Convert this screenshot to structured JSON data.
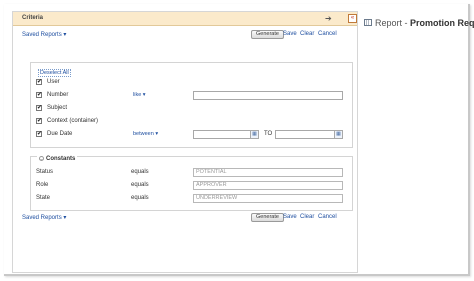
{
  "panel": {
    "title": "Criteria",
    "arrow_glyph": "➔",
    "collapse_glyph": "«"
  },
  "toolbar_top": {
    "saved_reports": "Saved Reports ▾",
    "generate": "Generate",
    "save": "Save",
    "clear": "Clear",
    "cancel": "Cancel"
  },
  "toolbar_bottom": {
    "saved_reports": "Saved Reports ▾",
    "generate": "Generate",
    "save": "Save",
    "clear": "Clear",
    "cancel": "Cancel"
  },
  "criteria": {
    "deselect_all": "Deselect All",
    "check_glyph": "✔",
    "rows": [
      {
        "label": "User",
        "checked": true,
        "operator": "",
        "value": ""
      },
      {
        "label": "Number",
        "checked": true,
        "operator": "like ▾",
        "value": ""
      },
      {
        "label": "Subject",
        "checked": true,
        "operator": "",
        "value": ""
      },
      {
        "label": "Context (container)",
        "checked": true,
        "operator": "",
        "value": ""
      },
      {
        "label": "Due Date",
        "checked": true,
        "operator": "between ▾",
        "value": "",
        "to_label": "TO",
        "to_value": ""
      }
    ]
  },
  "constants": {
    "title": "Constants",
    "rows": [
      {
        "label": "Status",
        "operator": "equals",
        "value": "POTENTIAL"
      },
      {
        "label": "Role",
        "operator": "equals",
        "value": "APPROVER"
      },
      {
        "label": "State",
        "operator": "equals",
        "value": "UNDERREVIEW"
      }
    ]
  },
  "right_header": {
    "prefix": "Report - ",
    "title": "Promotion Requ"
  }
}
